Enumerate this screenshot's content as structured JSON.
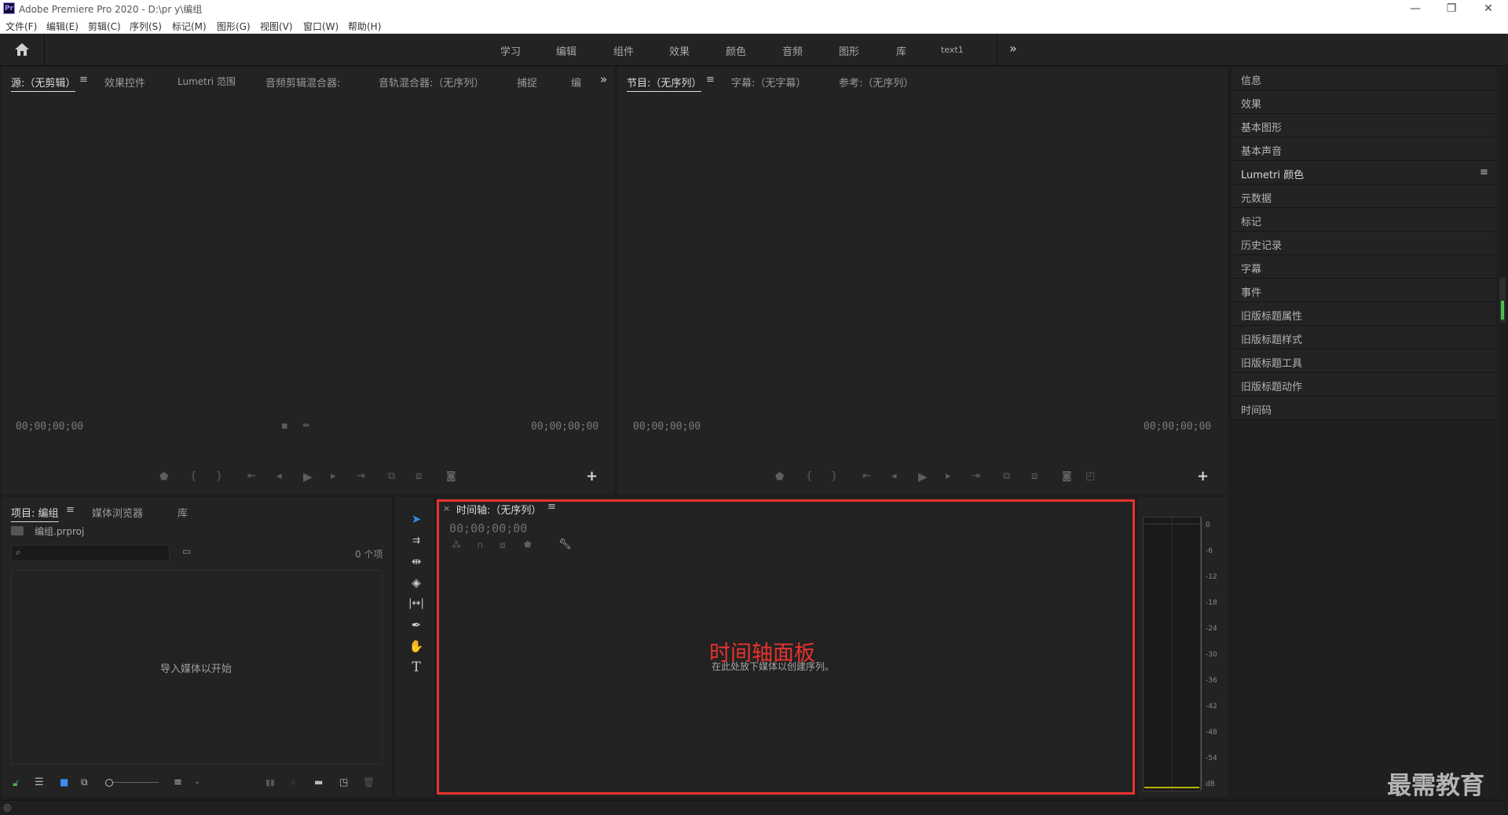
{
  "window": {
    "app_icon": "Pr",
    "title": "Adobe Premiere Pro 2020 - D:\\pr y\\编组",
    "controls": [
      "—",
      "❐",
      "✕"
    ]
  },
  "menu": [
    "文件(F)",
    "编辑(E)",
    "剪辑(C)",
    "序列(S)",
    "标记(M)",
    "图形(G)",
    "视图(V)",
    "窗口(W)",
    "帮助(H)"
  ],
  "workspaces": [
    "学习",
    "编辑",
    "组件",
    "效果",
    "颜色",
    "音频",
    "图形",
    "库",
    "text1"
  ],
  "workspaces_more": "»",
  "source_panel": {
    "tabs": [
      "源:（无剪辑）",
      "效果控件",
      "Lumetri 范围",
      "音频剪辑混合器:",
      "音轨混合器:（无序列）",
      "捕捉",
      "编"
    ],
    "more": "»",
    "timecode_left": "00;00;00;00",
    "timecode_right": "00;00;00;00"
  },
  "program_panel": {
    "tabs": [
      "节目:（无序列）",
      "字幕:（无字幕）",
      "参考:（无序列）"
    ],
    "timecode_left": "00;00;00;00",
    "timecode_right": "00;00;00;00"
  },
  "right_panels": [
    "信息",
    "效果",
    "基本图形",
    "基本声音",
    "Lumetri 颜色",
    "元数据",
    "标记",
    "历史记录",
    "字幕",
    "事件",
    "旧版标题属性",
    "旧版标题样式",
    "旧版标题工具",
    "旧版标题动作",
    "时间码"
  ],
  "project_panel": {
    "tabs": [
      "项目: 编组",
      "媒体浏览器",
      "库"
    ],
    "file_name": "编组.prproj",
    "item_count": "0 个项",
    "empty_text": "导入媒体以开始"
  },
  "timeline_panel": {
    "tab": "时间轴:（无序列）",
    "timecode": "00;00;00;00",
    "drop_hint": "在此处放下媒体以创建序列。",
    "annotation": "时间轴面板",
    "annotation_color": "#e8322f"
  },
  "audio_meter": {
    "labels": [
      "0",
      "-6",
      "-12",
      "-18",
      "-24",
      "-30",
      "-36",
      "-42",
      "-48",
      "-54",
      "dB"
    ]
  },
  "watermark": "最需教育"
}
